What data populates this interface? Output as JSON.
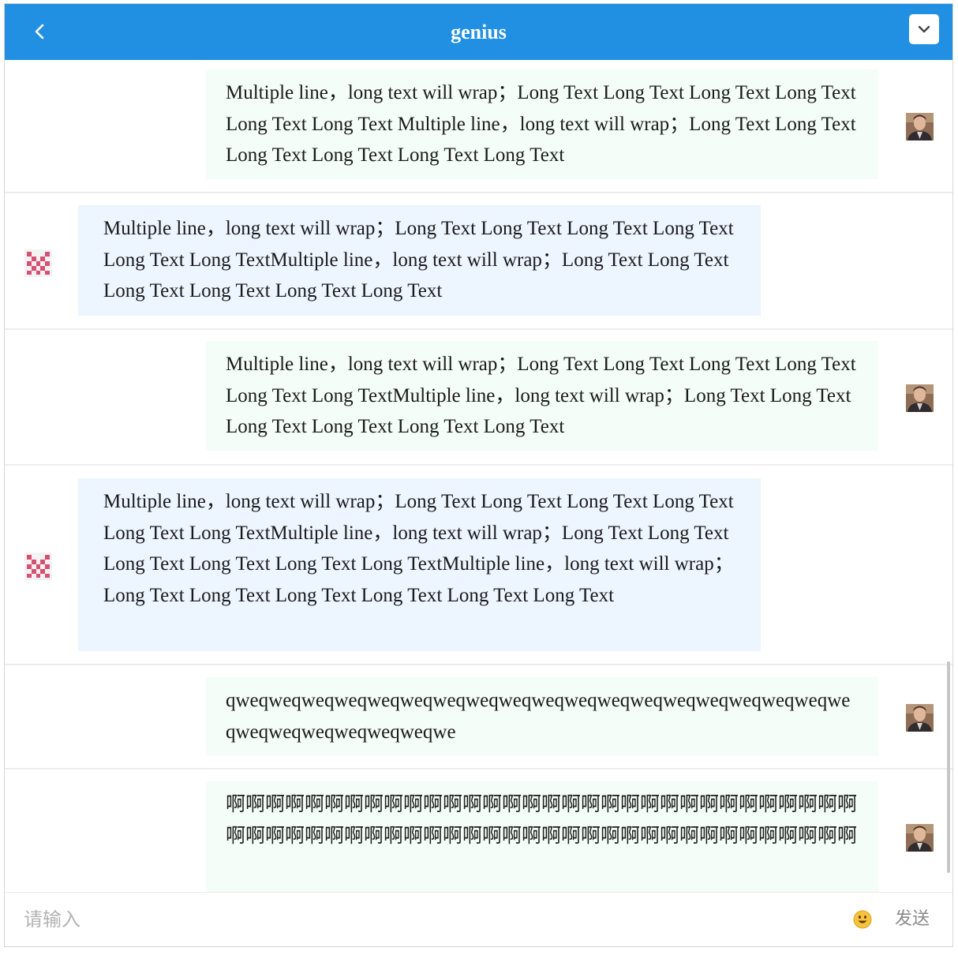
{
  "header": {
    "title": "genius",
    "back_icon": "chevron-left-icon",
    "menu_icon": "chevron-down-icon",
    "color": "#2190e3"
  },
  "messages": [
    {
      "side": "right",
      "avatar": "user-photo-avatar",
      "text": "Multiple line，long text will wrap；Long Text Long Text Long Text Long Text Long Text Long Text Multiple line，long text will wrap；Long Text Long Text Long Text Long Text Long Text Long Text"
    },
    {
      "side": "left",
      "avatar": "pixel-identicon-avatar",
      "text": "Multiple line，long text will wrap；Long Text Long Text Long Text Long Text Long Text Long TextMultiple line，long text will wrap；Long Text Long Text Long Text Long Text Long Text Long Text"
    },
    {
      "side": "right",
      "avatar": "user-photo-avatar",
      "text": "Multiple line，long text will wrap；Long Text Long Text Long Text Long Text Long Text Long TextMultiple line，long text will wrap；Long Text Long Text Long Text Long Text Long Text Long Text"
    },
    {
      "side": "left",
      "avatar": "pixel-identicon-avatar",
      "text": "Multiple line，long text will wrap；Long Text Long Text Long Text Long Text Long Text Long TextMultiple line，long text will wrap；Long Text Long Text Long Text Long Text Long Text Long TextMultiple line，long text will wrap；Long Text Long Text Long Text Long Text Long Text Long Text"
    },
    {
      "side": "right",
      "avatar": "user-photo-avatar",
      "text": "qweqweqweqweqweqweqweqweqweqweqweqweqweqweqweqweqweqweqweqweqweqweqweqweqweqwe"
    },
    {
      "side": "right",
      "avatar": "user-photo-avatar",
      "text": "啊啊啊啊啊啊啊啊啊啊啊啊啊啊啊啊啊啊啊啊啊啊啊啊啊啊啊啊啊啊啊啊啊啊啊啊啊啊啊啊啊啊啊啊啊啊啊啊啊啊啊啊啊啊啊啊啊啊啊啊啊啊啊啊"
    }
  ],
  "composer": {
    "placeholder": "请输入",
    "emoji_icon": "smiley-face-icon",
    "send_label": "发送"
  }
}
